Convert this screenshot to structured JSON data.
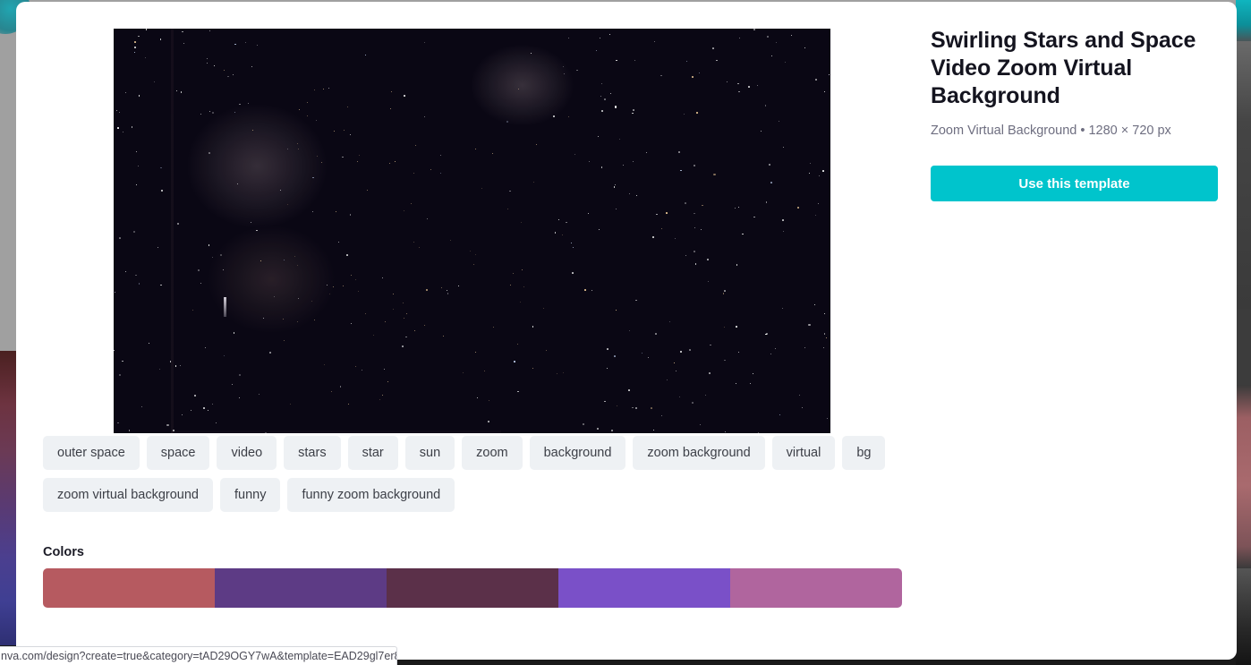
{
  "template": {
    "title": "Swirling Stars and Space Video Zoom Virtual Background",
    "meta": "Zoom Virtual Background • 1280 × 720 px",
    "use_button_label": "Use this template"
  },
  "tags": [
    {
      "label": "outer space"
    },
    {
      "label": "space"
    },
    {
      "label": "video"
    },
    {
      "label": "stars"
    },
    {
      "label": "star"
    },
    {
      "label": "sun"
    },
    {
      "label": "zoom"
    },
    {
      "label": "background"
    },
    {
      "label": "zoom background"
    },
    {
      "label": "virtual"
    },
    {
      "label": "bg"
    },
    {
      "label": "zoom virtual background"
    },
    {
      "label": "funny"
    },
    {
      "label": "funny zoom background"
    }
  ],
  "colors": {
    "heading": "Colors",
    "swatches": [
      {
        "hex": "#b65a60"
      },
      {
        "hex": "#5d3b85"
      },
      {
        "hex": "#5b3049"
      },
      {
        "hex": "#7a50c8"
      },
      {
        "hex": "#b0659e"
      }
    ]
  },
  "status_bar": {
    "url": "nva.com/design?create=true&category=tAD29OGY7wA&template=EAD29gl7er8…"
  },
  "preview": {
    "alt": "Swirling stars and space nebula video thumbnail"
  },
  "theme": {
    "accent": "#00c4cc",
    "panel_bg": "#ffffff",
    "tag_bg": "#eef1f4",
    "title_color": "#14141f",
    "meta_color": "#6e6e80"
  }
}
